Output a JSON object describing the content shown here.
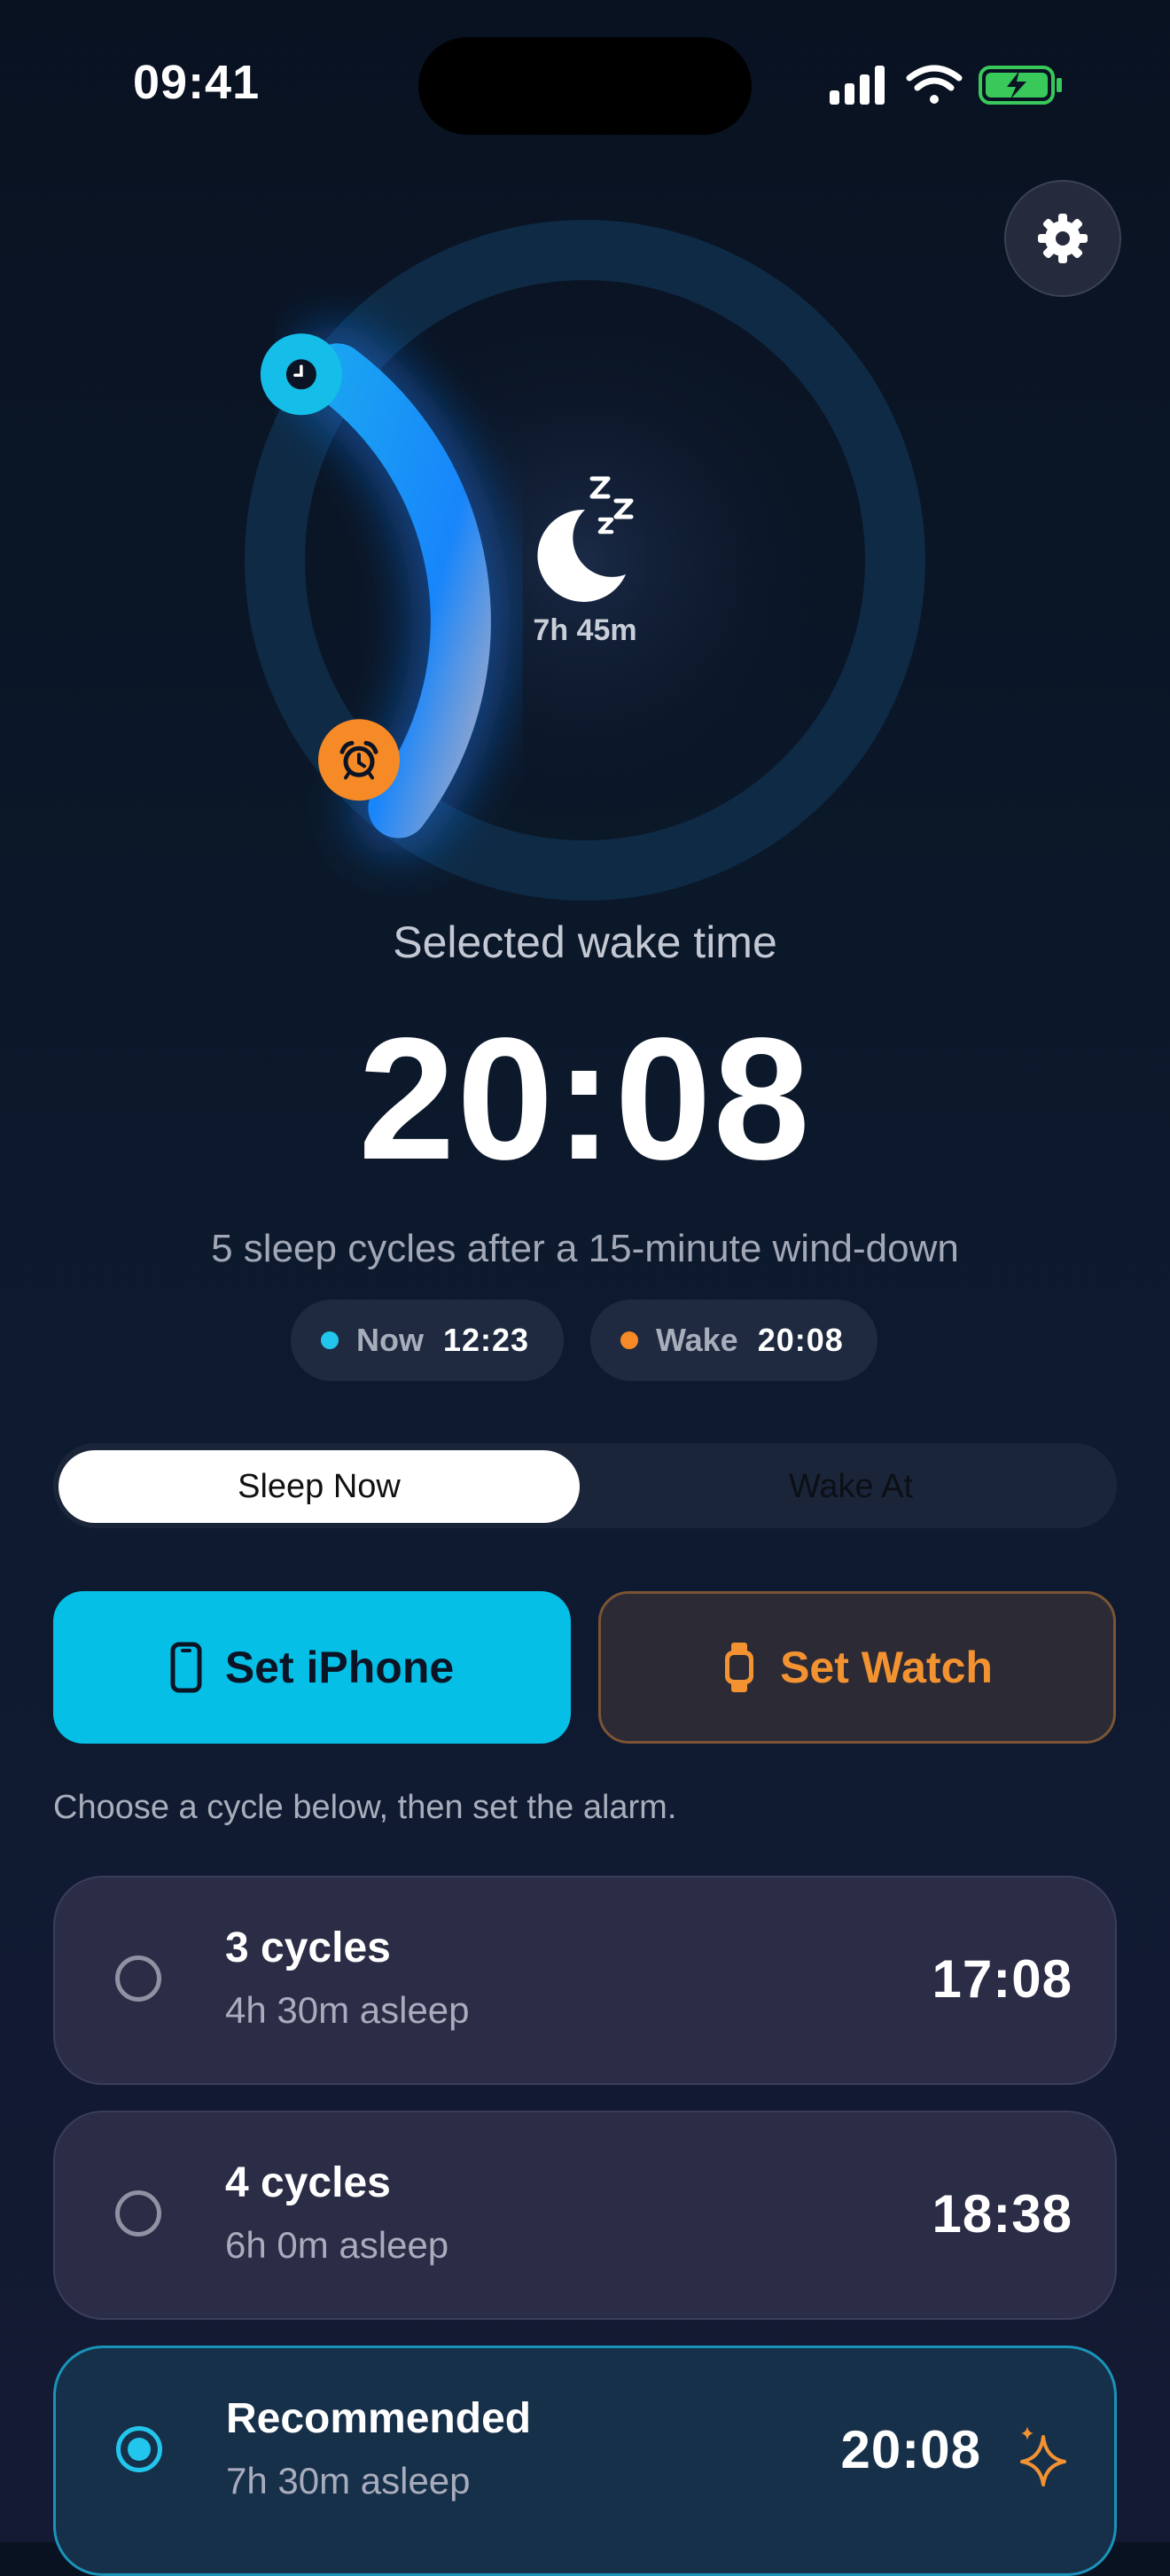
{
  "status_bar": {
    "time": "09:41"
  },
  "icons": {
    "settings": "gear-icon",
    "center": "moon-zzz-icon",
    "start_handle": "alarm-clock-icon",
    "end_handle": "clock-icon",
    "set_iphone": "iphone-icon",
    "set_watch": "watch-icon",
    "recommended": "sparkle-icon"
  },
  "dial": {
    "duration": "7h 45m",
    "arc_fraction_of_circle": 0.25,
    "colors": {
      "track": "#0e2a44",
      "arc_start": "#1aa3f2",
      "arc_mid": "#1885fb",
      "arc_end": "#7f9bd0",
      "alarm": "#f58a26",
      "clock": "#15bde9"
    }
  },
  "summary": {
    "caption": "Selected wake time",
    "wake_time": "20:08",
    "subtitle": "5 sleep cycles after a 15-minute wind-down"
  },
  "chips": {
    "now": {
      "label": "Now",
      "value": "12:23",
      "color": "#22c6ec"
    },
    "wake": {
      "label": "Wake",
      "value": "20:08",
      "color": "#f58a26"
    }
  },
  "mode_toggle": {
    "options": [
      "Sleep Now",
      "Wake At"
    ],
    "selected": "Sleep Now"
  },
  "actions": {
    "set_iphone": "Set iPhone",
    "set_watch": "Set Watch",
    "hint": "Choose a cycle below, then set the alarm."
  },
  "cycles": [
    {
      "title": "3 cycles",
      "subtitle": "4h 30m asleep",
      "time": "17:08",
      "selected": false
    },
    {
      "title": "4 cycles",
      "subtitle": "6h 0m asleep",
      "time": "18:38",
      "selected": false
    },
    {
      "title": "Recommended",
      "subtitle": "7h 30m asleep",
      "time": "20:08",
      "selected": true
    }
  ]
}
